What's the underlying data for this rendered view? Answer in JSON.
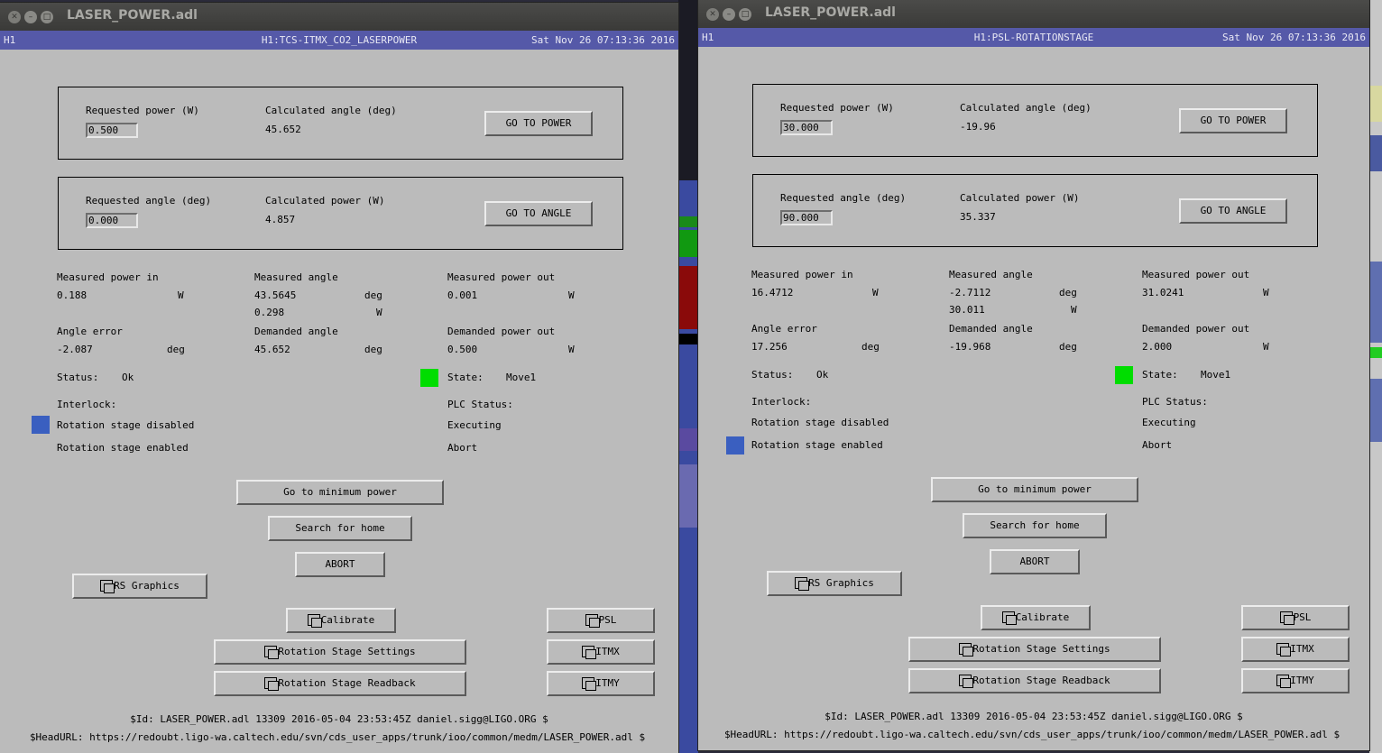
{
  "windows": [
    {
      "title": "LASER_POWER.adl",
      "header": {
        "system": "H1",
        "channel": "H1:TCS-ITMX_CO2_LASERPOWER",
        "datetime": "Sat Nov 26 07:13:36 2016"
      },
      "power_box": {
        "req_label": "Requested power (W)",
        "req_value": "0.500",
        "calc_label": "Calculated angle (deg)",
        "calc_value": "45.652",
        "button": "GO TO POWER"
      },
      "angle_box": {
        "req_label": "Requested angle (deg)",
        "req_value": "0.000",
        "calc_label": "Calculated power (W)",
        "calc_value": "4.857",
        "button": "GO TO ANGLE"
      },
      "readings": {
        "mp_in_label": "Measured power in",
        "mp_in_value": "0.188",
        "mp_in_unit": "W",
        "ma_label": "Measured angle",
        "ma_value": "43.5645",
        "ma_unit": "deg",
        "ma_sub_value": "0.298",
        "ma_sub_unit": "W",
        "mp_out_label": "Measured power out",
        "mp_out_value": "0.001",
        "mp_out_unit": "W",
        "ae_label": "Angle error",
        "ae_value": "-2.087",
        "ae_unit": "deg",
        "da_label": "Demanded angle",
        "da_value": "45.652",
        "da_unit": "deg",
        "dp_label": "Demanded power out",
        "dp_value": "0.500",
        "dp_unit": "W"
      },
      "status": {
        "status_label": "Status:",
        "status_value": "Ok",
        "state_label": "State:",
        "state_value": "Move1",
        "state_color": "#00dd00"
      },
      "interlock": {
        "label": "Interlock:",
        "disabled": "Rotation stage disabled",
        "enabled": "Rotation stage enabled",
        "indicator_color": "#3a5fc0",
        "active": "disabled"
      },
      "plc": {
        "label": "PLC Status:",
        "executing": "Executing",
        "abort": "Abort"
      },
      "buttons": {
        "min_power": "Go to minimum power",
        "search_home": "Search for home",
        "abort": "ABORT",
        "rs_graphics": "RS Graphics",
        "calibrate": "Calibrate",
        "rs_settings": "Rotation Stage Settings",
        "rs_readback": "Rotation Stage Readback",
        "psl": "PSL",
        "itmx": "ITMX",
        "itmy": "ITMY"
      },
      "footer": {
        "id": "$Id: LASER_POWER.adl 13309 2016-05-04 23:53:45Z daniel.sigg@LIGO.ORG $",
        "url": "$HeadURL: https://redoubt.ligo-wa.caltech.edu/svn/cds_user_apps/trunk/ioo/common/medm/LASER_POWER.adl $"
      }
    },
    {
      "title": "LASER_POWER.adl",
      "header": {
        "system": "H1",
        "channel": "H1:PSL-ROTATIONSTAGE",
        "datetime": "Sat Nov 26 07:13:36 2016"
      },
      "power_box": {
        "req_label": "Requested power (W)",
        "req_value": "30.000",
        "calc_label": "Calculated angle (deg)",
        "calc_value": "-19.96",
        "button": "GO TO POWER"
      },
      "angle_box": {
        "req_label": "Requested angle (deg)",
        "req_value": "90.000",
        "calc_label": "Calculated power (W)",
        "calc_value": "35.337",
        "button": "GO TO ANGLE"
      },
      "readings": {
        "mp_in_label": "Measured power in",
        "mp_in_value": "16.4712",
        "mp_in_unit": "W",
        "ma_label": "Measured angle",
        "ma_value": "-2.7112",
        "ma_unit": "deg",
        "ma_sub_value": "30.011",
        "ma_sub_unit": "W",
        "mp_out_label": "Measured power out",
        "mp_out_value": "31.0241",
        "mp_out_unit": "W",
        "ae_label": "Angle error",
        "ae_value": "17.256",
        "ae_unit": "deg",
        "da_label": "Demanded angle",
        "da_value": "-19.968",
        "da_unit": "deg",
        "dp_label": "Demanded power out",
        "dp_value": "2.000",
        "dp_unit": "W"
      },
      "status": {
        "status_label": "Status:",
        "status_value": "Ok",
        "state_label": "State:",
        "state_value": "Move1",
        "state_color": "#00dd00"
      },
      "interlock": {
        "label": "Interlock:",
        "disabled": "Rotation stage disabled",
        "enabled": "Rotation stage enabled",
        "indicator_color": "#3a5fc0",
        "active": "enabled"
      },
      "plc": {
        "label": "PLC Status:",
        "executing": "Executing",
        "abort": "Abort"
      },
      "buttons": {
        "min_power": "Go to minimum power",
        "search_home": "Search for home",
        "abort": "ABORT",
        "rs_graphics": "RS Graphics",
        "calibrate": "Calibrate",
        "rs_settings": "Rotation Stage Settings",
        "rs_readback": "Rotation Stage Readback",
        "psl": "PSL",
        "itmx": "ITMX",
        "itmy": "ITMY"
      },
      "footer": {
        "id": "$Id: LASER_POWER.adl 13309 2016-05-04 23:53:45Z daniel.sigg@LIGO.ORG $",
        "url": "$HeadURL: https://redoubt.ligo-wa.caltech.edu/svn/cds_user_apps/trunk/ioo/common/medm/LASER_POWER.adl $"
      }
    }
  ]
}
